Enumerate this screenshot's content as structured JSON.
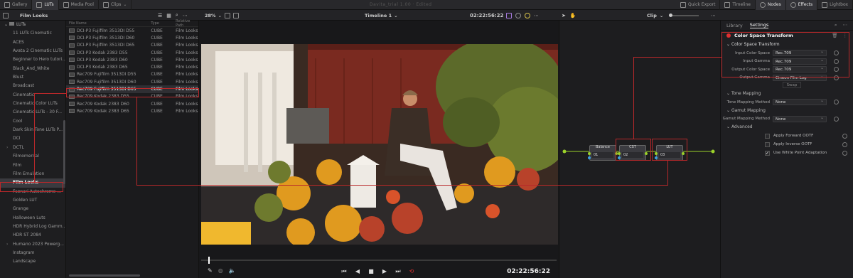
{
  "topbar": {
    "gallery": "Gallery",
    "luts": "LUTs",
    "media_pool": "Media Pool",
    "clips": "Clips",
    "project_title": "Davita_trial 1.00 · Edited",
    "quick_export": "Quick Export",
    "timeline": "Timeline",
    "nodes": "Nodes",
    "effects": "Effects",
    "lightbox": "Lightbox"
  },
  "toolbar2": {
    "folder_title": "Film Looks",
    "zoom": "28%",
    "timeline_name": "Timeline 1",
    "timecode": "02:22:56:22",
    "clip_label": "Clip"
  },
  "tree": {
    "root": "LUTs",
    "items": [
      {
        "label": "11 LUTs Cinematic",
        "expandable": false
      },
      {
        "label": "ACES",
        "expandable": false
      },
      {
        "label": "Avata 2 Cinematic LUTs",
        "expandable": false
      },
      {
        "label": "Beginner to Hero tutori...",
        "expandable": false
      },
      {
        "label": "Black_And_White",
        "expandable": false
      },
      {
        "label": "Blust",
        "expandable": false
      },
      {
        "label": "Broadcast",
        "expandable": false
      },
      {
        "label": "Cinematic",
        "expandable": false
      },
      {
        "label": "Cinematic Color LUTs",
        "expandable": false
      },
      {
        "label": "Cinematic LUTs - 30 F...",
        "expandable": false
      },
      {
        "label": "Cool",
        "expandable": false
      },
      {
        "label": "Dark Skin Tone LUTs P...",
        "expandable": false
      },
      {
        "label": "DCI",
        "expandable": false
      },
      {
        "label": "DCTL",
        "expandable": true
      },
      {
        "label": "Filmomental",
        "expandable": false
      },
      {
        "label": "Film",
        "expandable": false
      },
      {
        "label": "Film Emulation",
        "expandable": false
      },
      {
        "label": "Film Looks",
        "expandable": false,
        "selected": true
      },
      {
        "label": "Fsonari Autochrome ...",
        "expandable": false
      },
      {
        "label": "Golden LUT",
        "expandable": false
      },
      {
        "label": "Grange",
        "expandable": false
      },
      {
        "label": "Halloween Luts",
        "expandable": false
      },
      {
        "label": "HDR Hybrid Log Gamm...",
        "expandable": false
      },
      {
        "label": "HDR ST 2084",
        "expandable": false
      },
      {
        "label": "Humano 2023 Powerg...",
        "expandable": true
      },
      {
        "label": "Instagram",
        "expandable": false
      },
      {
        "label": "Landscape",
        "expandable": false
      }
    ]
  },
  "filelist": {
    "headers": [
      "File Name",
      "Type",
      "Relative Path"
    ],
    "rows": [
      {
        "name": "DCI-P3 Fujifilm 3513DI D55",
        "type": "CUBE",
        "path": "Film Looks"
      },
      {
        "name": "DCI-P3 Fujifilm 3513DI D60",
        "type": "CUBE",
        "path": "Film Looks"
      },
      {
        "name": "DCI-P3 Fujifilm 3513DI D65",
        "type": "CUBE",
        "path": "Film Looks"
      },
      {
        "name": "DCI-P3 Kodak 2383 D55",
        "type": "CUBE",
        "path": "Film Looks"
      },
      {
        "name": "DCI-P3 Kodak 2383 D60",
        "type": "CUBE",
        "path": "Film Looks"
      },
      {
        "name": "DCI-P3 Kodak 2383 D65",
        "type": "CUBE",
        "path": "Film Looks"
      },
      {
        "name": "Rec709 Fujifilm 3513DI D55",
        "type": "CUBE",
        "path": "Film Looks"
      },
      {
        "name": "Rec709 Fujifilm 3513DI D60",
        "type": "CUBE",
        "path": "Film Looks"
      },
      {
        "name": "Rec709 Fujifilm 3513DI D65",
        "type": "CUBE",
        "path": "Film Looks",
        "selected": true
      },
      {
        "name": "Rec709 Kodak 2383 D55",
        "type": "CUBE",
        "path": "Film Looks"
      },
      {
        "name": "Rec709 Kodak 2383 D60",
        "type": "CUBE",
        "path": "Film Looks"
      },
      {
        "name": "Rec709 Kodak 2383 D65",
        "type": "CUBE",
        "path": "Film Looks"
      }
    ]
  },
  "viewer": {
    "timecode": "02:22:56:22",
    "playhead_fraction": 0.02
  },
  "nodes": [
    {
      "title": "Balance",
      "number": "01"
    },
    {
      "title": "CST",
      "number": "02"
    },
    {
      "title": "LUT",
      "number": "03"
    }
  ],
  "inspector": {
    "tab_library": "Library",
    "tab_settings": "Settings",
    "panel_title": "Color Space Transform",
    "section_cst": "Color Space Transform",
    "input_color_space_label": "Input Color Space",
    "input_color_space": "Rec.709",
    "input_gamma_label": "Input Gamma",
    "input_gamma": "Rec.709",
    "output_color_space_label": "Output Color Space",
    "output_color_space": "Rec.709",
    "output_gamma_label": "Output Gamma",
    "output_gamma": "Cineon Film Log",
    "swap": "Swap",
    "section_tone": "Tone Mapping",
    "tone_method_label": "Tone Mapping Method",
    "tone_method": "None",
    "section_gamut": "Gamut Mapping",
    "gamut_method_label": "Gamut Mapping Method",
    "gamut_method": "None",
    "section_advanced": "Advanced",
    "opt_forward": "Apply Forward OOTF",
    "opt_inverse": "Apply Inverse OOTF",
    "opt_white": "Use White Point Adaptation",
    "opt_forward_checked": false,
    "opt_inverse_checked": false,
    "opt_white_checked": true
  },
  "colors": {
    "annotation_red": "#b8282a",
    "node_link_green": "#9bd12a",
    "port_blue": "#3aa0e0"
  }
}
